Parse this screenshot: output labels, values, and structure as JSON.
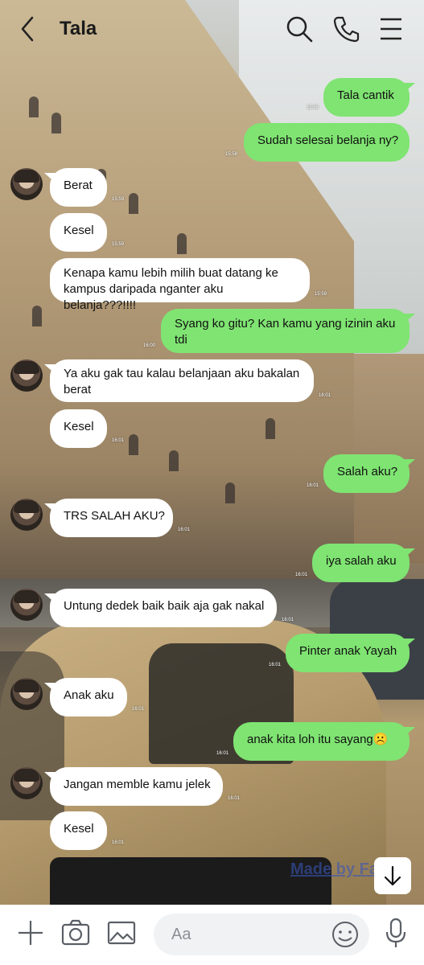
{
  "header": {
    "title": "Tala"
  },
  "messages": [
    {
      "side": "out",
      "text": "Tala cantik",
      "time": "15:58"
    },
    {
      "side": "out",
      "text": "Sudah selesai belanja ny?",
      "time": "15:58"
    },
    {
      "side": "in",
      "text": "Berat",
      "time": "15:59"
    },
    {
      "side": "in",
      "text": "Kesel",
      "time": "15:59"
    },
    {
      "side": "in",
      "text": "Kenapa kamu lebih milih buat datang ke kampus daripada nganter aku belanja???!!!!",
      "time": "15:59"
    },
    {
      "side": "out",
      "text": "Syang ko gitu? Kan kamu yang izinin aku tdi",
      "time": "16:00"
    },
    {
      "side": "in",
      "text": "Ya aku gak tau kalau belanjaan aku bakalan berat",
      "time": "16:01"
    },
    {
      "side": "in",
      "text": "Kesel",
      "time": "16:01"
    },
    {
      "side": "out",
      "text": "Salah aku?",
      "time": "16:01"
    },
    {
      "side": "in",
      "text": "TRS SALAH AKU?",
      "time": "16:01"
    },
    {
      "side": "out",
      "text": "iya salah aku",
      "time": "16:01"
    },
    {
      "side": "in",
      "text": "Untung dedek baik baik aja gak nakal",
      "time": "16:01"
    },
    {
      "side": "out",
      "text": "Pinter anak Yayah",
      "time": "16:01"
    },
    {
      "side": "in",
      "text": "Anak aku",
      "time": "16:01"
    },
    {
      "side": "out",
      "text": "anak kita loh itu sayang☹️",
      "time": "16:01"
    },
    {
      "side": "in",
      "text": "Jangan memble kamu jelek",
      "time": "16:01"
    },
    {
      "side": "in",
      "text": "Kesel",
      "time": "16:01"
    }
  ],
  "watermark": "Made by Fake",
  "input": {
    "placeholder": "Aa"
  },
  "colors": {
    "outgoing": "#7fe472",
    "incoming": "#ffffff"
  },
  "icons": [
    "back-arrow-icon",
    "search-icon",
    "phone-icon",
    "menu-icon",
    "scroll-down-icon",
    "plus-icon",
    "camera-icon",
    "image-icon",
    "emoji-icon",
    "mic-icon"
  ]
}
